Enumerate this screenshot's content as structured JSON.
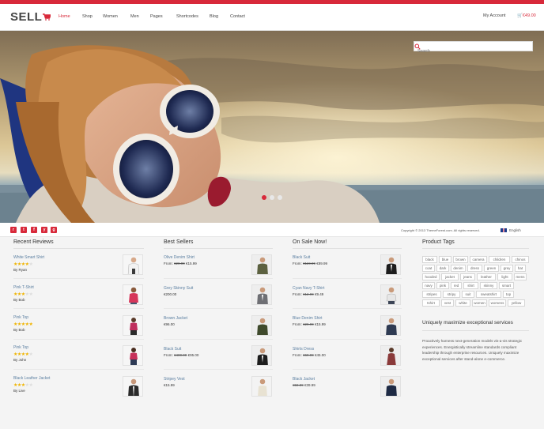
{
  "brand": {
    "logo": "SELL",
    "accent": "#d8293a"
  },
  "nav": {
    "items": [
      {
        "label": "Home",
        "active": true
      },
      {
        "label": "Shop"
      },
      {
        "label": "Women"
      },
      {
        "label": "Men"
      },
      {
        "label": "Pages"
      },
      {
        "label": "Shortcodes"
      },
      {
        "label": "Blog"
      },
      {
        "label": "Contact"
      }
    ],
    "account": "My Account",
    "cart": "€49.00"
  },
  "hero": {
    "search_placeholder": "Search",
    "slides": 3,
    "active_slide": 1
  },
  "subbar": {
    "social_icons": [
      "rss-icon",
      "twitter-icon",
      "facebook-icon",
      "youtube-icon",
      "google-plus-icon"
    ],
    "copyright": "Copyright © 2013 ThemeForest.com. All rights reserved.",
    "language": "English"
  },
  "recent_reviews": {
    "title": "Recent Reviews",
    "items": [
      {
        "name": "White Smart Shirt",
        "rating": 4,
        "by": "By Ryan"
      },
      {
        "name": "Pink T-Shirt",
        "rating": 3,
        "by": "By Bob"
      },
      {
        "name": "Pink Top",
        "rating": 5,
        "by": "By Bob"
      },
      {
        "name": "Pink Top",
        "rating": 4,
        "by": "By John"
      },
      {
        "name": "Black Leather Jacket",
        "rating": 3,
        "by": "By Live"
      }
    ]
  },
  "best_sellers": {
    "title": "Best Sellers",
    "items": [
      {
        "name": "Olive Denim Shirt",
        "from": "From:",
        "old": "€20.99",
        "price": "€15.99"
      },
      {
        "name": "Grey Skinny Suit",
        "price": "€200.00"
      },
      {
        "name": "Brown Jacket",
        "price": "€96.00"
      },
      {
        "name": "Black Suit",
        "from": "From:",
        "old": "€400.00",
        "price": "€95.00"
      },
      {
        "name": "Stripey Vest",
        "price": "€15.99"
      }
    ]
  },
  "on_sale": {
    "title": "On Sale Now!",
    "items": [
      {
        "name": "Black Suit",
        "from": "From:",
        "old": "€119.99",
        "price": "€89.99"
      },
      {
        "name": "Cyan Navy T-Shirt",
        "from": "From:",
        "old": "€12.99",
        "price": "€9.49"
      },
      {
        "name": "Blue Denim Shirt",
        "from": "From:",
        "old": "€29.99",
        "price": "€15.99"
      },
      {
        "name": "Shirts Dress",
        "from": "From:",
        "old": "€69.99",
        "price": "€45.00"
      },
      {
        "name": "Black Jacket",
        "old": "€59.99",
        "price": "€39.99"
      }
    ]
  },
  "product_tags": {
    "title": "Product Tags",
    "tags": [
      "black",
      "blue",
      "brown",
      "camera",
      "children",
      "chinos",
      "coat",
      "dark",
      "denim",
      "dress",
      "green",
      "grey",
      "hat",
      "hooded",
      "jacket",
      "jeans",
      "leather",
      "light",
      "mens",
      "navy",
      "pink",
      "red",
      "shirt",
      "skinny",
      "smart",
      "stripes",
      "stripy",
      "suit",
      "sweatshirt",
      "top",
      "tshirt",
      "vest",
      "white",
      "women",
      "womens",
      "yellow"
    ]
  },
  "promo": {
    "title": "Uniquely maximize exceptional services",
    "text": "Proactively harness next-generation models vis-a-vis strategic experiences. Energistically streamline standards compliant leadership through enterprise resources. Uniquely maximize exceptional services after stand-alone e-commerce."
  }
}
